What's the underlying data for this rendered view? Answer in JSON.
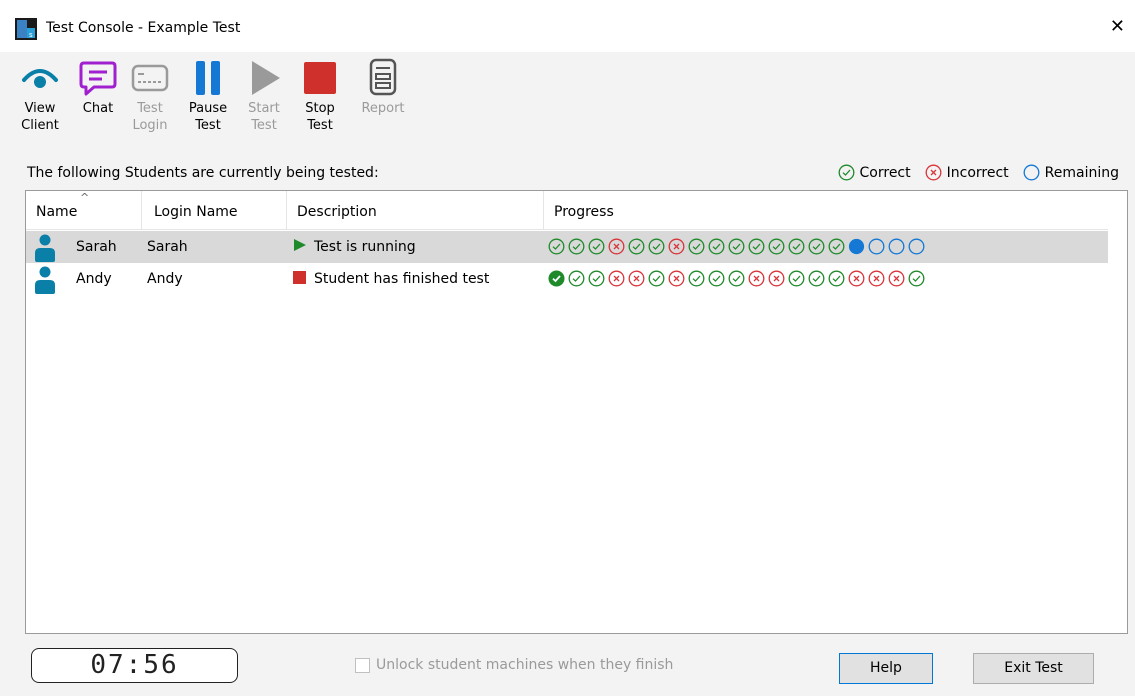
{
  "window": {
    "title": "Test Console - Example Test"
  },
  "toolbar": {
    "view_client": [
      "View",
      "Client"
    ],
    "chat": [
      "Chat",
      ""
    ],
    "test_login": [
      "Test",
      "Login"
    ],
    "pause_test": [
      "Pause",
      "Test"
    ],
    "start_test": [
      "Start",
      "Test"
    ],
    "stop_test": [
      "Stop",
      "Test"
    ],
    "report": [
      "Report",
      ""
    ]
  },
  "caption": "The following Students are currently being tested:",
  "legend": {
    "correct": "Correct",
    "incorrect": "Incorrect",
    "remaining": "Remaining"
  },
  "colors": {
    "correct": "#1e8a2a",
    "incorrect": "#d9343a",
    "remaining": "#1478d4",
    "accent": "#0a7fa8"
  },
  "table": {
    "headers": [
      "Name",
      "Login Name",
      "Description",
      "Progress"
    ],
    "rows": [
      {
        "name": "Sarah",
        "login": "Sarah",
        "description": "Test is running",
        "status": "running",
        "progress": [
          "c",
          "c",
          "c",
          "x",
          "c",
          "c",
          "x",
          "c",
          "c",
          "c",
          "c",
          "c",
          "c",
          "c",
          "c",
          "cur",
          "r",
          "r",
          "r"
        ]
      },
      {
        "name": "Andy",
        "login": "Andy",
        "description": "Student has finished test",
        "status": "finished",
        "progress": [
          "cf",
          "c",
          "c",
          "x",
          "x",
          "c",
          "x",
          "c",
          "c",
          "c",
          "x",
          "x",
          "c",
          "c",
          "c",
          "x",
          "x",
          "x",
          "c"
        ]
      }
    ]
  },
  "footer": {
    "timer": "07:56",
    "unlock_label": "Unlock student machines when they finish",
    "help": "Help",
    "exit": "Exit Test"
  }
}
